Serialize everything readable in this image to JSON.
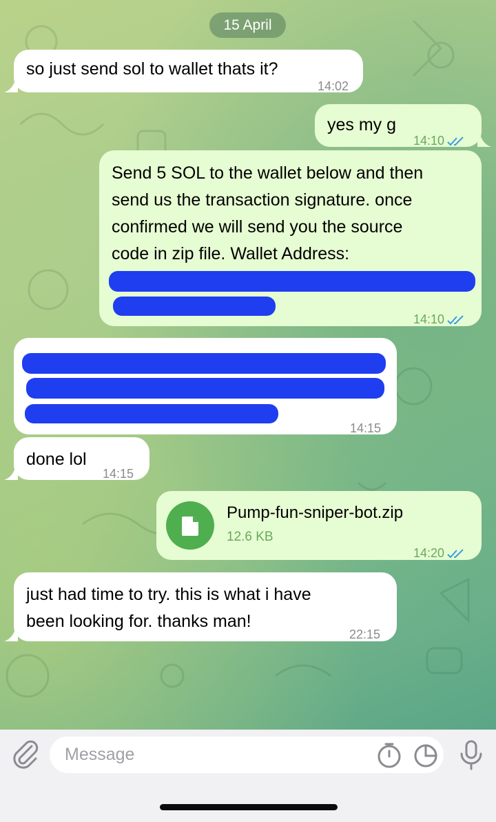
{
  "date_separator": "15 April",
  "messages": [
    {
      "text": "so just send sol to wallet thats it?",
      "time": "14:02"
    },
    {
      "text": "yes my g",
      "time": "14:10"
    },
    {
      "lines": [
        "Send 5 SOL to the wallet below and then",
        "send us the transaction signature. once",
        "confirmed we will send you the source",
        "code in zip file. Wallet Address:"
      ],
      "time": "14:10"
    },
    {
      "time": "14:15"
    },
    {
      "text": "done lol",
      "time": "14:15"
    },
    {
      "file_name": "Pump-fun-sniper-bot.zip",
      "file_size": "12.6 KB",
      "time": "14:20"
    },
    {
      "lines": [
        "just had time to try. this is what i have",
        "been looking for. thanks man!"
      ],
      "time": "22:15"
    }
  ],
  "composer": {
    "placeholder": "Message"
  },
  "colors": {
    "incoming_bubble": "#ffffff",
    "outgoing_bubble": "#e6fcd2",
    "read_ticks": "#3a9de0",
    "redaction": "#1f3ef0"
  }
}
